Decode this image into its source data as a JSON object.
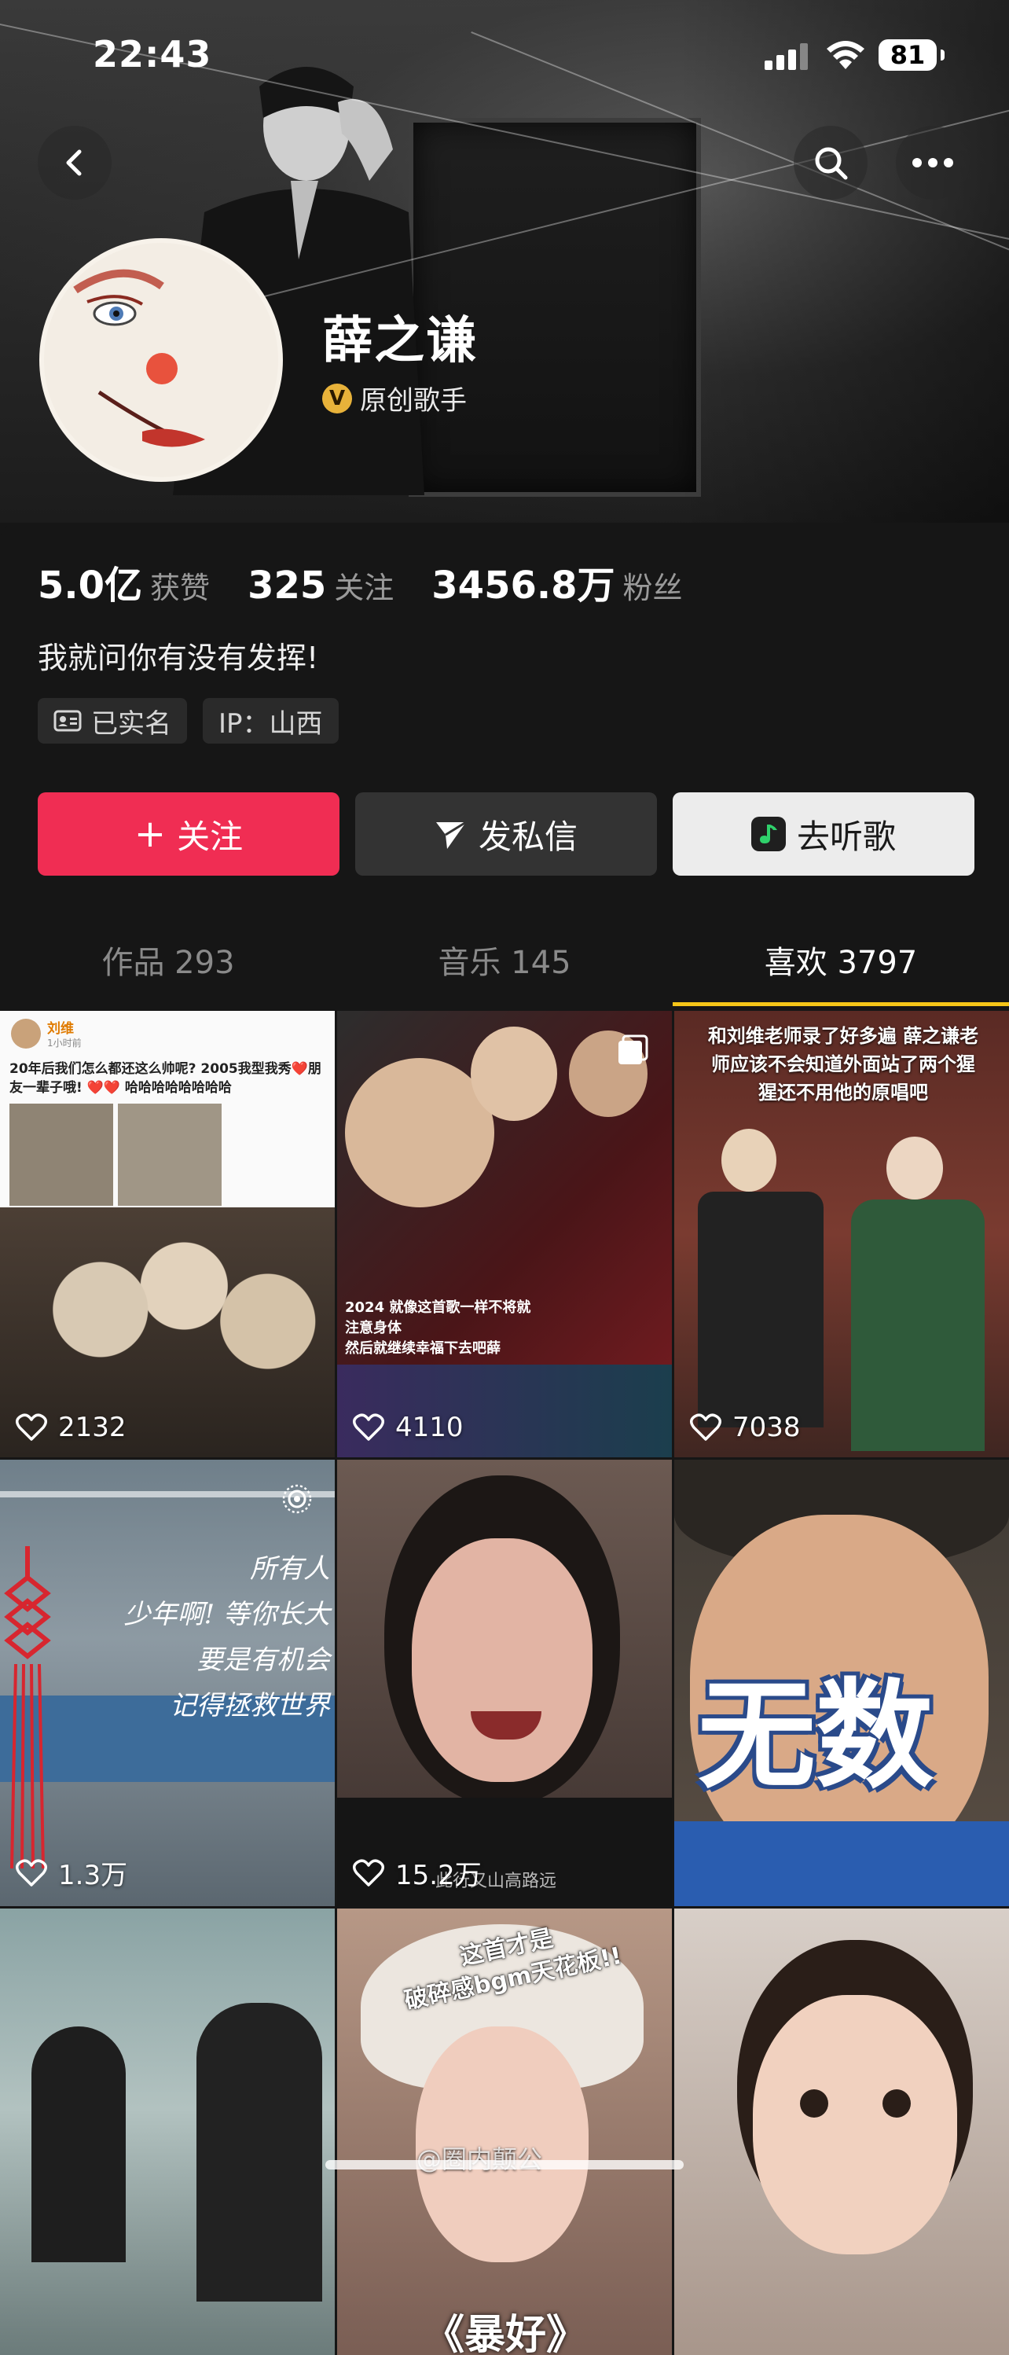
{
  "status_bar": {
    "time": "22:43",
    "battery": "81"
  },
  "profile": {
    "name": "薛之谦",
    "verified_label": "原创歌手",
    "verify_badge": "V",
    "bio": "我就问你有没有发挥!",
    "tags": [
      {
        "icon": "id-card-icon",
        "label": "已实名"
      },
      {
        "label": "IP：山西"
      }
    ]
  },
  "stats": [
    {
      "value": "5.0亿",
      "label": "获赞"
    },
    {
      "value": "325",
      "label": "关注"
    },
    {
      "value": "3456.8万",
      "label": "粉丝"
    }
  ],
  "actions": {
    "follow": "关注",
    "follow_icon": "+",
    "message": "发私信",
    "listen": "去听歌"
  },
  "tabs": [
    {
      "label": "作品 293",
      "active": false
    },
    {
      "label": "音乐 145",
      "active": false
    },
    {
      "label": "喜欢 3797",
      "active": true
    }
  ],
  "videos": [
    {
      "likes": "2132",
      "post_user": "刘维",
      "post_time": "1小时前",
      "post_text": "20年后我们怎么都还这么帅呢? 2005我型我秀❤️朋友一辈子哦! ❤️❤️ 哈哈哈哈哈哈哈哈"
    },
    {
      "likes": "4110",
      "caption": "2024 就像这首歌一样不将就\n注意身体\n然后就继续幸福下去吧薛"
    },
    {
      "likes": "7038",
      "caption": "和刘维老师录了好多遍 薛之谦老师应该不会知道外面站了两个猩猩还不用他的原唱吧"
    },
    {
      "likes": "1.3万",
      "caption": "所有人\n少年啊! 等你长大\n要是有机会\n记得拯救世界"
    },
    {
      "likes": "15.2万",
      "caption": "此行又山高路远"
    },
    {
      "likes": "",
      "caption": "无数"
    },
    {
      "likes": "",
      "caption": ""
    },
    {
      "likes": "",
      "caption": "这首才是\n破碎感bgm天花板!!",
      "caption2": "《暴好》"
    },
    {
      "likes": "",
      "caption": ""
    }
  ],
  "watermark": "@圈内颠公"
}
